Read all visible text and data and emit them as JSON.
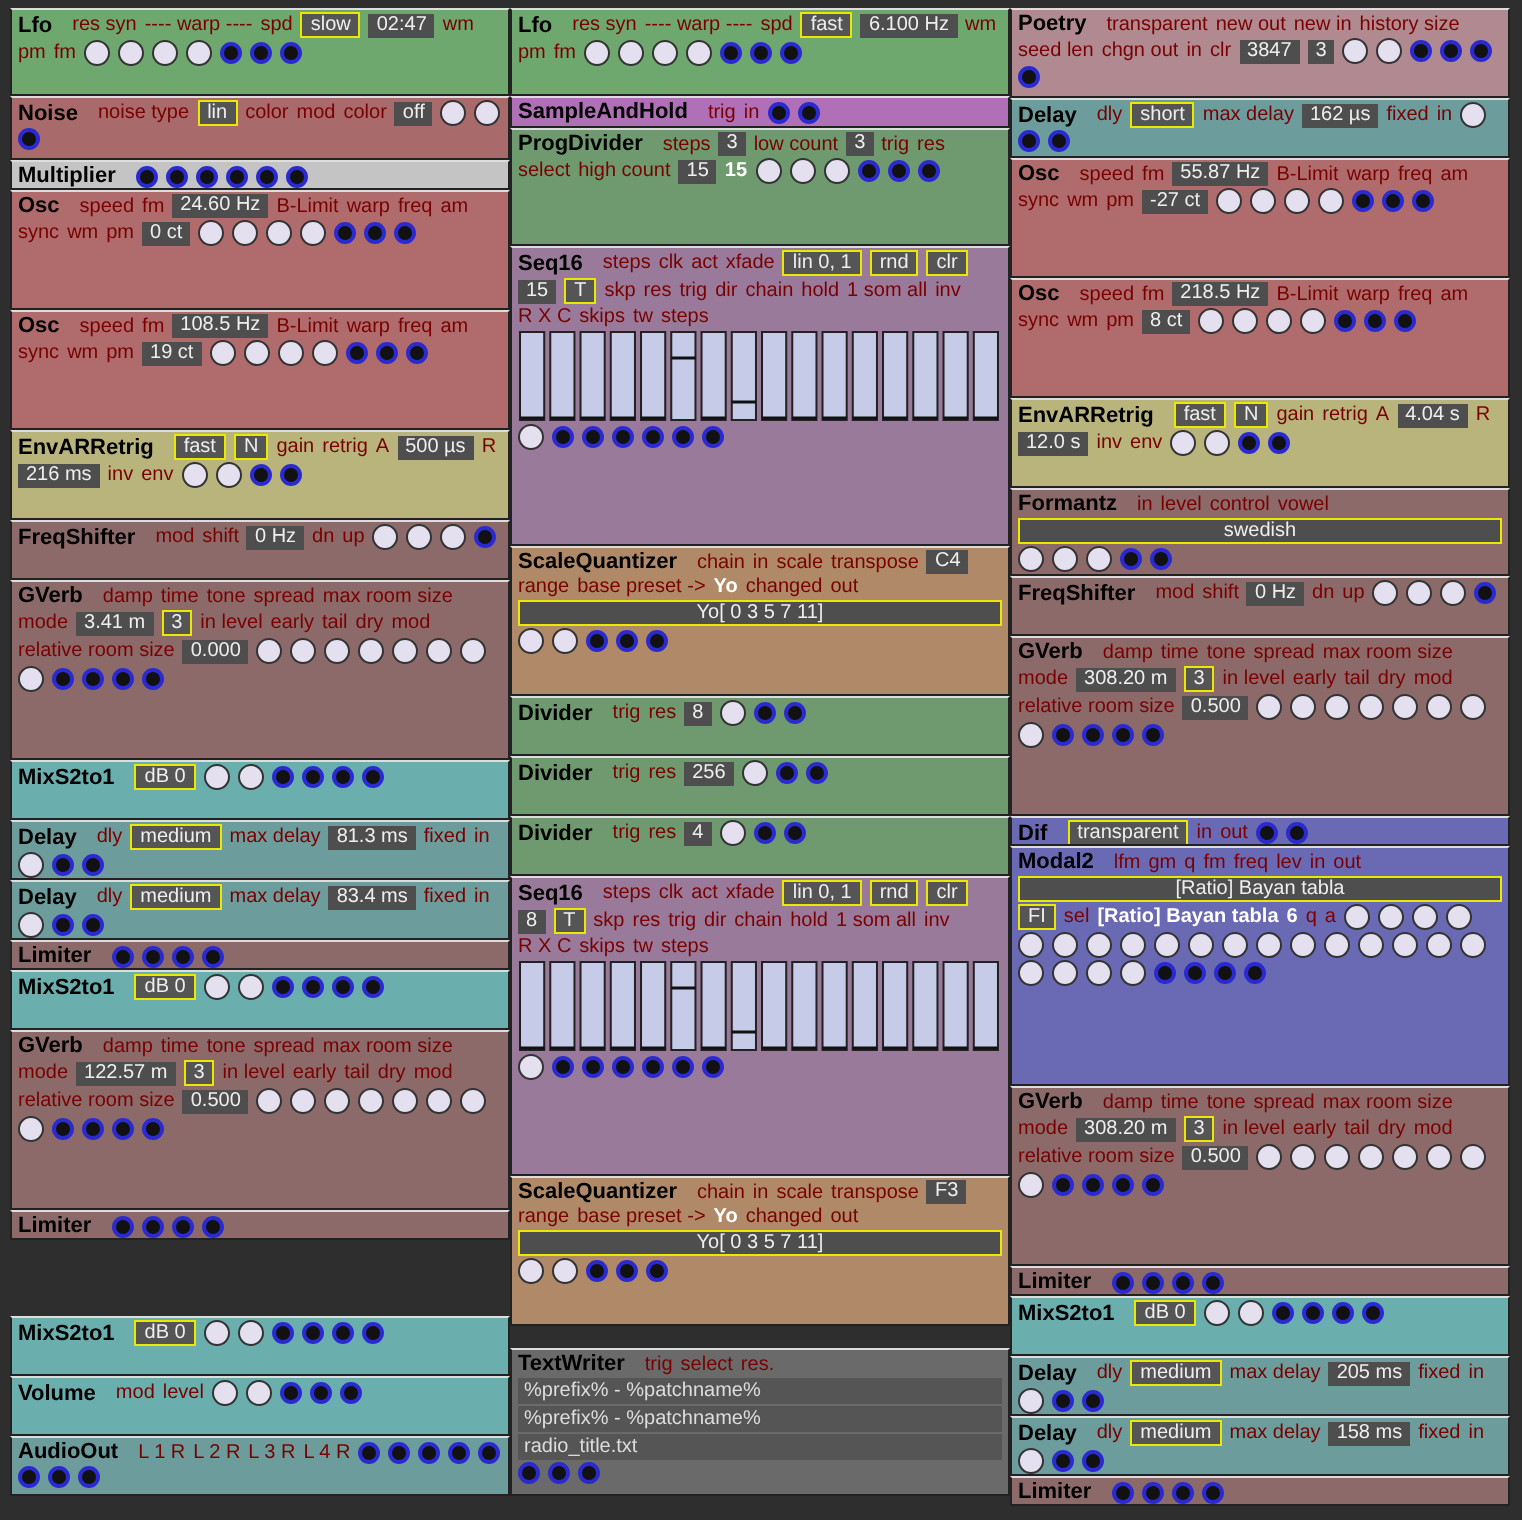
{
  "columns": [
    {
      "stacks": [
        [
          {
            "kind": "lfo",
            "title": "Lfo",
            "items": [
              {
                "kind": "label",
                "text": "res syn"
              },
              {
                "kind": "label",
                "text": "---- warp ----"
              },
              {
                "kind": "label",
                "text": "spd"
              },
              {
                "kind": "button",
                "text": "slow"
              },
              {
                "kind": "display",
                "text": "02:47"
              },
              {
                "kind": "label",
                "text": "wm"
              },
              {
                "kind": "label",
                "text": "pm"
              },
              {
                "kind": "label",
                "text": "fm"
              }
            ]
          },
          {
            "kind": "noise",
            "title": "Noise",
            "items": [
              {
                "kind": "label",
                "text": "noise type"
              },
              {
                "kind": "button",
                "text": "lin"
              },
              {
                "kind": "label",
                "text": "color"
              },
              {
                "kind": "label",
                "text": "mod"
              },
              {
                "kind": "label",
                "text": "color"
              },
              {
                "kind": "display",
                "text": "off"
              }
            ]
          },
          {
            "kind": "multiplier",
            "title": "Multiplier"
          },
          {
            "kind": "osc",
            "title": "Osc",
            "items": [
              {
                "kind": "label",
                "text": "speed"
              },
              {
                "kind": "label",
                "text": "fm"
              },
              {
                "kind": "display",
                "text": "24.60 Hz"
              },
              {
                "kind": "label",
                "text": "B-Limit"
              },
              {
                "kind": "label",
                "text": "warp"
              },
              {
                "kind": "label",
                "text": "freq"
              },
              {
                "kind": "label",
                "text": "am"
              },
              {
                "kind": "label",
                "text": "sync"
              },
              {
                "kind": "label",
                "text": "wm"
              },
              {
                "kind": "label",
                "text": "pm"
              },
              {
                "kind": "display",
                "text": "0 ct"
              }
            ]
          },
          {
            "kind": "osc",
            "title": "Osc",
            "items": [
              {
                "kind": "label",
                "text": "speed"
              },
              {
                "kind": "label",
                "text": "fm"
              },
              {
                "kind": "display",
                "text": "108.5 Hz"
              },
              {
                "kind": "label",
                "text": "B-Limit"
              },
              {
                "kind": "label",
                "text": "warp"
              },
              {
                "kind": "label",
                "text": "freq"
              },
              {
                "kind": "label",
                "text": "am"
              },
              {
                "kind": "label",
                "text": "sync"
              },
              {
                "kind": "label",
                "text": "wm"
              },
              {
                "kind": "label",
                "text": "pm"
              },
              {
                "kind": "display",
                "text": "19 ct"
              }
            ]
          },
          {
            "kind": "env",
            "title": "EnvARRetrig",
            "items": [
              {
                "kind": "button",
                "text": "fast"
              },
              {
                "kind": "button",
                "text": "N"
              },
              {
                "kind": "label",
                "text": "gain"
              },
              {
                "kind": "label",
                "text": "retrig"
              },
              {
                "kind": "label",
                "text": "A"
              },
              {
                "kind": "display",
                "text": "500 µs"
              },
              {
                "kind": "label",
                "text": "R"
              },
              {
                "kind": "display",
                "text": "216 ms"
              },
              {
                "kind": "label",
                "text": "inv"
              },
              {
                "kind": "label",
                "text": "env"
              }
            ]
          },
          {
            "kind": "freqshifter",
            "title": "FreqShifter",
            "items": [
              {
                "kind": "label",
                "text": "mod"
              },
              {
                "kind": "label",
                "text": "shift"
              },
              {
                "kind": "display",
                "text": "0 Hz"
              },
              {
                "kind": "label",
                "text": "dn"
              },
              {
                "kind": "label",
                "text": "up"
              }
            ]
          },
          {
            "kind": "gverb",
            "title": "GVerb",
            "items": [
              {
                "kind": "label",
                "text": "damp"
              },
              {
                "kind": "label",
                "text": "time"
              },
              {
                "kind": "label",
                "text": "tone"
              },
              {
                "kind": "label",
                "text": "spread"
              },
              {
                "kind": "label",
                "text": "max room size"
              },
              {
                "kind": "label",
                "text": "mode"
              },
              {
                "kind": "display",
                "text": "3.41 m"
              },
              {
                "kind": "button",
                "text": "3"
              },
              {
                "kind": "label",
                "text": "in level"
              },
              {
                "kind": "label",
                "text": "early"
              },
              {
                "kind": "label",
                "text": "tail"
              },
              {
                "kind": "label",
                "text": "dry"
              },
              {
                "kind": "label",
                "text": "mod"
              },
              {
                "kind": "label",
                "text": "relative room size"
              },
              {
                "kind": "display",
                "text": "0.000"
              }
            ]
          },
          {
            "kind": "mix",
            "title": "MixS2to1",
            "items": [
              {
                "kind": "button",
                "text": "dB 0"
              }
            ]
          },
          {
            "kind": "delay",
            "title": "Delay",
            "items": [
              {
                "kind": "label",
                "text": "dly"
              },
              {
                "kind": "button",
                "text": "medium"
              },
              {
                "kind": "label",
                "text": "max delay"
              },
              {
                "kind": "display",
                "text": "81.3 ms"
              },
              {
                "kind": "label",
                "text": "fixed"
              },
              {
                "kind": "label",
                "text": "in"
              }
            ]
          },
          {
            "kind": "delay",
            "title": "Delay",
            "items": [
              {
                "kind": "label",
                "text": "dly"
              },
              {
                "kind": "button",
                "text": "medium"
              },
              {
                "kind": "label",
                "text": "max delay"
              },
              {
                "kind": "display",
                "text": "83.4 ms"
              },
              {
                "kind": "label",
                "text": "fixed"
              },
              {
                "kind": "label",
                "text": "in"
              }
            ]
          },
          {
            "kind": "limiter",
            "title": "Limiter"
          },
          {
            "kind": "mix",
            "title": "MixS2to1",
            "items": [
              {
                "kind": "button",
                "text": "dB 0"
              }
            ]
          },
          {
            "kind": "gverb",
            "title": "GVerb",
            "items": [
              {
                "kind": "label",
                "text": "damp"
              },
              {
                "kind": "label",
                "text": "time"
              },
              {
                "kind": "label",
                "text": "tone"
              },
              {
                "kind": "label",
                "text": "spread"
              },
              {
                "kind": "label",
                "text": "max room size"
              },
              {
                "kind": "label",
                "text": "mode"
              },
              {
                "kind": "display",
                "text": "122.57 m"
              },
              {
                "kind": "button",
                "text": "3"
              },
              {
                "kind": "label",
                "text": "in level"
              },
              {
                "kind": "label",
                "text": "early"
              },
              {
                "kind": "label",
                "text": "tail"
              },
              {
                "kind": "label",
                "text": "dry"
              },
              {
                "kind": "label",
                "text": "mod"
              },
              {
                "kind": "label",
                "text": "relative room size"
              },
              {
                "kind": "display",
                "text": "0.500"
              }
            ]
          },
          {
            "kind": "limiter",
            "title": "Limiter"
          }
        ],
        [
          {
            "kind": "mix",
            "title": "MixS2to1",
            "items": [
              {
                "kind": "button",
                "text": "dB 0"
              }
            ]
          },
          {
            "kind": "volume",
            "title": "Volume",
            "items": [
              {
                "kind": "label",
                "text": "mod"
              },
              {
                "kind": "label",
                "text": "level"
              }
            ]
          },
          {
            "kind": "audioout",
            "title": "AudioOut",
            "items": [
              {
                "kind": "label",
                "text": "L 1 R"
              },
              {
                "kind": "label",
                "text": "L 2 R"
              },
              {
                "kind": "label",
                "text": "L 3 R"
              },
              {
                "kind": "label",
                "text": "L 4 R"
              }
            ]
          }
        ]
      ]
    },
    {
      "stacks": [
        [
          {
            "kind": "lfo",
            "title": "Lfo",
            "items": [
              {
                "kind": "label",
                "text": "res syn"
              },
              {
                "kind": "label",
                "text": "---- warp ----"
              },
              {
                "kind": "label",
                "text": "spd"
              },
              {
                "kind": "button",
                "text": "fast"
              },
              {
                "kind": "display",
                "text": "6.100 Hz"
              },
              {
                "kind": "label",
                "text": "wm"
              },
              {
                "kind": "label",
                "text": "pm"
              },
              {
                "kind": "label",
                "text": "fm"
              }
            ]
          },
          {
            "kind": "sah",
            "title": "SampleAndHold",
            "items": [
              {
                "kind": "label",
                "text": "trig"
              },
              {
                "kind": "label",
                "text": "in"
              }
            ]
          },
          {
            "kind": "progdivider",
            "title": "ProgDivider",
            "items": [
              {
                "kind": "label",
                "text": "steps"
              },
              {
                "kind": "display",
                "text": "3"
              },
              {
                "kind": "label",
                "text": "low count"
              },
              {
                "kind": "display",
                "text": "3"
              },
              {
                "kind": "label",
                "text": "trig"
              },
              {
                "kind": "label",
                "text": "res"
              },
              {
                "kind": "label",
                "text": "select"
              },
              {
                "kind": "label",
                "text": "high count"
              },
              {
                "kind": "display",
                "text": "15"
              },
              {
                "kind": "text",
                "text": "15"
              }
            ]
          },
          {
            "kind": "seq16",
            "title": "Seq16",
            "items": [
              {
                "kind": "label",
                "text": "steps"
              },
              {
                "kind": "label",
                "text": "clk"
              },
              {
                "kind": "label",
                "text": "act"
              },
              {
                "kind": "label",
                "text": "xfade"
              },
              {
                "kind": "button",
                "text": "lin 0, 1"
              },
              {
                "kind": "button",
                "text": "rnd"
              },
              {
                "kind": "button",
                "text": "clr"
              },
              {
                "kind": "display",
                "text": "15"
              },
              {
                "kind": "button",
                "text": "T"
              },
              {
                "kind": "label",
                "text": "skp"
              },
              {
                "kind": "label",
                "text": "res"
              },
              {
                "kind": "label",
                "text": "trig"
              },
              {
                "kind": "label",
                "text": "dir"
              },
              {
                "kind": "label",
                "text": "chain"
              },
              {
                "kind": "label",
                "text": "hold"
              },
              {
                "kind": "label",
                "text": "1 som all"
              },
              {
                "kind": "label",
                "text": "inv"
              },
              {
                "kind": "label",
                "text": "R X C"
              },
              {
                "kind": "label",
                "text": "skips"
              },
              {
                "kind": "label",
                "text": "tw"
              },
              {
                "kind": "label",
                "text": "steps"
              }
            ]
          },
          {
            "kind": "quantizer",
            "title": "ScaleQuantizer",
            "items": [
              {
                "kind": "label",
                "text": "chain"
              },
              {
                "kind": "label",
                "text": "in"
              },
              {
                "kind": "label",
                "text": "scale"
              },
              {
                "kind": "label",
                "text": "transpose"
              },
              {
                "kind": "display",
                "text": "C4"
              },
              {
                "kind": "label",
                "text": "range"
              },
              {
                "kind": "label",
                "text": "base preset ->"
              },
              {
                "kind": "text",
                "text": "Yo"
              },
              {
                "kind": "label",
                "text": "changed"
              },
              {
                "kind": "label",
                "text": "out"
              },
              {
                "kind": "wide",
                "text": "Yo[ 0 3 5 7 11]"
              }
            ]
          },
          {
            "kind": "divider",
            "title": "Divider",
            "items": [
              {
                "kind": "label",
                "text": "trig"
              },
              {
                "kind": "label",
                "text": "res"
              },
              {
                "kind": "display",
                "text": "8"
              }
            ]
          },
          {
            "kind": "divider",
            "title": "Divider",
            "items": [
              {
                "kind": "label",
                "text": "trig"
              },
              {
                "kind": "label",
                "text": "res"
              },
              {
                "kind": "display",
                "text": "256"
              }
            ]
          },
          {
            "kind": "divider",
            "title": "Divider",
            "items": [
              {
                "kind": "label",
                "text": "trig"
              },
              {
                "kind": "label",
                "text": "res"
              },
              {
                "kind": "display",
                "text": "4"
              }
            ]
          },
          {
            "kind": "seq16",
            "title": "Seq16",
            "items": [
              {
                "kind": "label",
                "text": "steps"
              },
              {
                "kind": "label",
                "text": "clk"
              },
              {
                "kind": "label",
                "text": "act"
              },
              {
                "kind": "label",
                "text": "xfade"
              },
              {
                "kind": "button",
                "text": "lin 0, 1"
              },
              {
                "kind": "button",
                "text": "rnd"
              },
              {
                "kind": "button",
                "text": "clr"
              },
              {
                "kind": "display",
                "text": "8"
              },
              {
                "kind": "button",
                "text": "T"
              },
              {
                "kind": "label",
                "text": "skp"
              },
              {
                "kind": "label",
                "text": "res"
              },
              {
                "kind": "label",
                "text": "trig"
              },
              {
                "kind": "label",
                "text": "dir"
              },
              {
                "kind": "label",
                "text": "chain"
              },
              {
                "kind": "label",
                "text": "hold"
              },
              {
                "kind": "label",
                "text": "1 som all"
              },
              {
                "kind": "label",
                "text": "inv"
              },
              {
                "kind": "label",
                "text": "R X C"
              },
              {
                "kind": "label",
                "text": "skips"
              },
              {
                "kind": "label",
                "text": "tw"
              },
              {
                "kind": "label",
                "text": "steps"
              }
            ]
          },
          {
            "kind": "quantizer",
            "title": "ScaleQuantizer",
            "items": [
              {
                "kind": "label",
                "text": "chain"
              },
              {
                "kind": "label",
                "text": "in"
              },
              {
                "kind": "label",
                "text": "scale"
              },
              {
                "kind": "label",
                "text": "transpose"
              },
              {
                "kind": "display",
                "text": "F3"
              },
              {
                "kind": "label",
                "text": "range"
              },
              {
                "kind": "label",
                "text": "base preset ->"
              },
              {
                "kind": "text",
                "text": "Yo"
              },
              {
                "kind": "label",
                "text": "changed"
              },
              {
                "kind": "label",
                "text": "out"
              },
              {
                "kind": "wide",
                "text": "Yo[ 0 3 5 7 11]"
              }
            ]
          }
        ],
        [
          {
            "kind": "textwriter",
            "title": "TextWriter",
            "items": [
              {
                "kind": "label",
                "text": "trig"
              },
              {
                "kind": "label",
                "text": "select"
              },
              {
                "kind": "label",
                "text": "res."
              },
              {
                "kind": "line",
                "text": "%prefix% - %patchname%"
              },
              {
                "kind": "line",
                "text": "%prefix% - %patchname%"
              },
              {
                "kind": "line",
                "text": "radio_title.txt"
              }
            ]
          }
        ]
      ]
    },
    {
      "stacks": [
        [
          {
            "kind": "poetry",
            "title": "Poetry",
            "items": [
              {
                "kind": "label",
                "text": "transparent"
              },
              {
                "kind": "label",
                "text": "new out"
              },
              {
                "kind": "label",
                "text": "new in"
              },
              {
                "kind": "label",
                "text": "history size"
              },
              {
                "kind": "label",
                "text": "seed len"
              },
              {
                "kind": "label",
                "text": "chgn out"
              },
              {
                "kind": "label",
                "text": "in"
              },
              {
                "kind": "label",
                "text": "clr"
              },
              {
                "kind": "display",
                "text": "3847"
              },
              {
                "kind": "display",
                "text": "3"
              }
            ]
          },
          {
            "kind": "delay",
            "title": "Delay",
            "items": [
              {
                "kind": "label",
                "text": "dly"
              },
              {
                "kind": "button",
                "text": "short"
              },
              {
                "kind": "label",
                "text": "max delay"
              },
              {
                "kind": "display",
                "text": "162 µs"
              },
              {
                "kind": "label",
                "text": "fixed"
              },
              {
                "kind": "label",
                "text": "in"
              }
            ]
          },
          {
            "kind": "osc",
            "title": "Osc",
            "items": [
              {
                "kind": "label",
                "text": "speed"
              },
              {
                "kind": "label",
                "text": "fm"
              },
              {
                "kind": "display",
                "text": "55.87 Hz"
              },
              {
                "kind": "label",
                "text": "B-Limit"
              },
              {
                "kind": "label",
                "text": "warp"
              },
              {
                "kind": "label",
                "text": "freq"
              },
              {
                "kind": "label",
                "text": "am"
              },
              {
                "kind": "label",
                "text": "sync"
              },
              {
                "kind": "label",
                "text": "wm"
              },
              {
                "kind": "label",
                "text": "pm"
              },
              {
                "kind": "display",
                "text": "-27 ct"
              }
            ]
          },
          {
            "kind": "osc",
            "title": "Osc",
            "items": [
              {
                "kind": "label",
                "text": "speed"
              },
              {
                "kind": "label",
                "text": "fm"
              },
              {
                "kind": "display",
                "text": "218.5 Hz"
              },
              {
                "kind": "label",
                "text": "B-Limit"
              },
              {
                "kind": "label",
                "text": "warp"
              },
              {
                "kind": "label",
                "text": "freq"
              },
              {
                "kind": "label",
                "text": "am"
              },
              {
                "kind": "label",
                "text": "sync"
              },
              {
                "kind": "label",
                "text": "wm"
              },
              {
                "kind": "label",
                "text": "pm"
              },
              {
                "kind": "display",
                "text": "8 ct"
              }
            ]
          },
          {
            "kind": "env",
            "title": "EnvARRetrig",
            "items": [
              {
                "kind": "button",
                "text": "fast"
              },
              {
                "kind": "button",
                "text": "N"
              },
              {
                "kind": "label",
                "text": "gain"
              },
              {
                "kind": "label",
                "text": "retrig"
              },
              {
                "kind": "label",
                "text": "A"
              },
              {
                "kind": "display",
                "text": "4.04 s"
              },
              {
                "kind": "label",
                "text": "R"
              },
              {
                "kind": "display",
                "text": "12.0 s"
              },
              {
                "kind": "label",
                "text": "inv"
              },
              {
                "kind": "label",
                "text": "env"
              }
            ]
          },
          {
            "kind": "formantz",
            "title": "Formantz",
            "items": [
              {
                "kind": "label",
                "text": "in"
              },
              {
                "kind": "label",
                "text": "level"
              },
              {
                "kind": "label",
                "text": "control"
              },
              {
                "kind": "label",
                "text": "vowel"
              },
              {
                "kind": "wide",
                "text": "swedish"
              }
            ]
          },
          {
            "kind": "freqshifter",
            "title": "FreqShifter",
            "items": [
              {
                "kind": "label",
                "text": "mod"
              },
              {
                "kind": "label",
                "text": "shift"
              },
              {
                "kind": "display",
                "text": "0 Hz"
              },
              {
                "kind": "label",
                "text": "dn"
              },
              {
                "kind": "label",
                "text": "up"
              }
            ]
          },
          {
            "kind": "gverb",
            "title": "GVerb",
            "items": [
              {
                "kind": "label",
                "text": "damp"
              },
              {
                "kind": "label",
                "text": "time"
              },
              {
                "kind": "label",
                "text": "tone"
              },
              {
                "kind": "label",
                "text": "spread"
              },
              {
                "kind": "label",
                "text": "max room size"
              },
              {
                "kind": "label",
                "text": "mode"
              },
              {
                "kind": "display",
                "text": "308.20 m"
              },
              {
                "kind": "button",
                "text": "3"
              },
              {
                "kind": "label",
                "text": "in level"
              },
              {
                "kind": "label",
                "text": "early"
              },
              {
                "kind": "label",
                "text": "tail"
              },
              {
                "kind": "label",
                "text": "dry"
              },
              {
                "kind": "label",
                "text": "mod"
              },
              {
                "kind": "label",
                "text": "relative room size"
              },
              {
                "kind": "display",
                "text": "0.500"
              }
            ]
          },
          {
            "kind": "dif",
            "title": "Dif",
            "items": [
              {
                "kind": "button",
                "text": "transparent"
              },
              {
                "kind": "label",
                "text": "in"
              },
              {
                "kind": "label",
                "text": "out"
              }
            ]
          },
          {
            "kind": "modal",
            "title": "Modal2",
            "items": [
              {
                "kind": "label",
                "text": "lfm"
              },
              {
                "kind": "label",
                "text": "gm"
              },
              {
                "kind": "label",
                "text": "q"
              },
              {
                "kind": "label",
                "text": "fm"
              },
              {
                "kind": "label",
                "text": "freq"
              },
              {
                "kind": "label",
                "text": "lev"
              },
              {
                "kind": "label",
                "text": "in"
              },
              {
                "kind": "label",
                "text": "out"
              },
              {
                "kind": "wide",
                "text": "[Ratio] Bayan tabla"
              },
              {
                "kind": "button",
                "text": "FI"
              },
              {
                "kind": "label",
                "text": "sel"
              },
              {
                "kind": "text",
                "text": "[Ratio] Bayan tabla"
              },
              {
                "kind": "text",
                "text": "6"
              },
              {
                "kind": "label",
                "text": "q"
              },
              {
                "kind": "label",
                "text": "a"
              }
            ]
          },
          {
            "kind": "gverb",
            "title": "GVerb",
            "items": [
              {
                "kind": "label",
                "text": "damp"
              },
              {
                "kind": "label",
                "text": "time"
              },
              {
                "kind": "label",
                "text": "tone"
              },
              {
                "kind": "label",
                "text": "spread"
              },
              {
                "kind": "label",
                "text": "max room size"
              },
              {
                "kind": "label",
                "text": "mode"
              },
              {
                "kind": "display",
                "text": "308.20 m"
              },
              {
                "kind": "button",
                "text": "3"
              },
              {
                "kind": "label",
                "text": "in level"
              },
              {
                "kind": "label",
                "text": "early"
              },
              {
                "kind": "label",
                "text": "tail"
              },
              {
                "kind": "label",
                "text": "dry"
              },
              {
                "kind": "label",
                "text": "mod"
              },
              {
                "kind": "label",
                "text": "relative room size"
              },
              {
                "kind": "display",
                "text": "0.500"
              }
            ]
          },
          {
            "kind": "limiter",
            "title": "Limiter"
          },
          {
            "kind": "mix",
            "title": "MixS2to1",
            "items": [
              {
                "kind": "button",
                "text": "dB 0"
              }
            ]
          },
          {
            "kind": "delay",
            "title": "Delay",
            "items": [
              {
                "kind": "label",
                "text": "dly"
              },
              {
                "kind": "button",
                "text": "medium"
              },
              {
                "kind": "label",
                "text": "max delay"
              },
              {
                "kind": "display",
                "text": "205 ms"
              },
              {
                "kind": "label",
                "text": "fixed"
              },
              {
                "kind": "label",
                "text": "in"
              }
            ]
          },
          {
            "kind": "delay",
            "title": "Delay",
            "items": [
              {
                "kind": "label",
                "text": "dly"
              },
              {
                "kind": "button",
                "text": "medium"
              },
              {
                "kind": "label",
                "text": "max delay"
              },
              {
                "kind": "display",
                "text": "158 ms"
              },
              {
                "kind": "label",
                "text": "fixed"
              },
              {
                "kind": "label",
                "text": "in"
              }
            ]
          },
          {
            "kind": "limiter",
            "title": "Limiter"
          }
        ]
      ]
    }
  ]
}
